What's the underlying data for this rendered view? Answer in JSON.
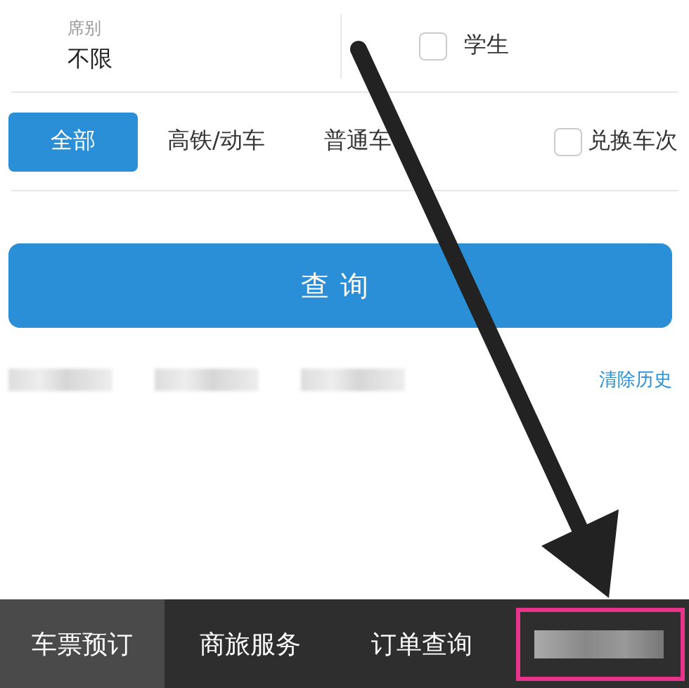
{
  "seat": {
    "label": "席别",
    "value": "不限"
  },
  "student": {
    "label": "学生",
    "checked": false
  },
  "filters": [
    {
      "label": "全部",
      "selected": true
    },
    {
      "label": "高铁/动车",
      "selected": false
    },
    {
      "label": "普通车",
      "selected": false
    }
  ],
  "exchange": {
    "label": "兑换车次",
    "checked": false
  },
  "search_button": "查询",
  "history": {
    "items": [
      {
        "kind": "blurred"
      },
      {
        "kind": "blurred"
      },
      {
        "kind": "blurred"
      }
    ],
    "clear": "清除历史"
  },
  "tab_bar": [
    {
      "kind": "text",
      "label": "车票预订",
      "selected": true
    },
    {
      "kind": "text",
      "label": "商旅服务",
      "selected": false
    },
    {
      "kind": "text",
      "label": "订单查询",
      "selected": false
    },
    {
      "kind": "blurred",
      "selected": false,
      "highlighted": true
    }
  ]
}
